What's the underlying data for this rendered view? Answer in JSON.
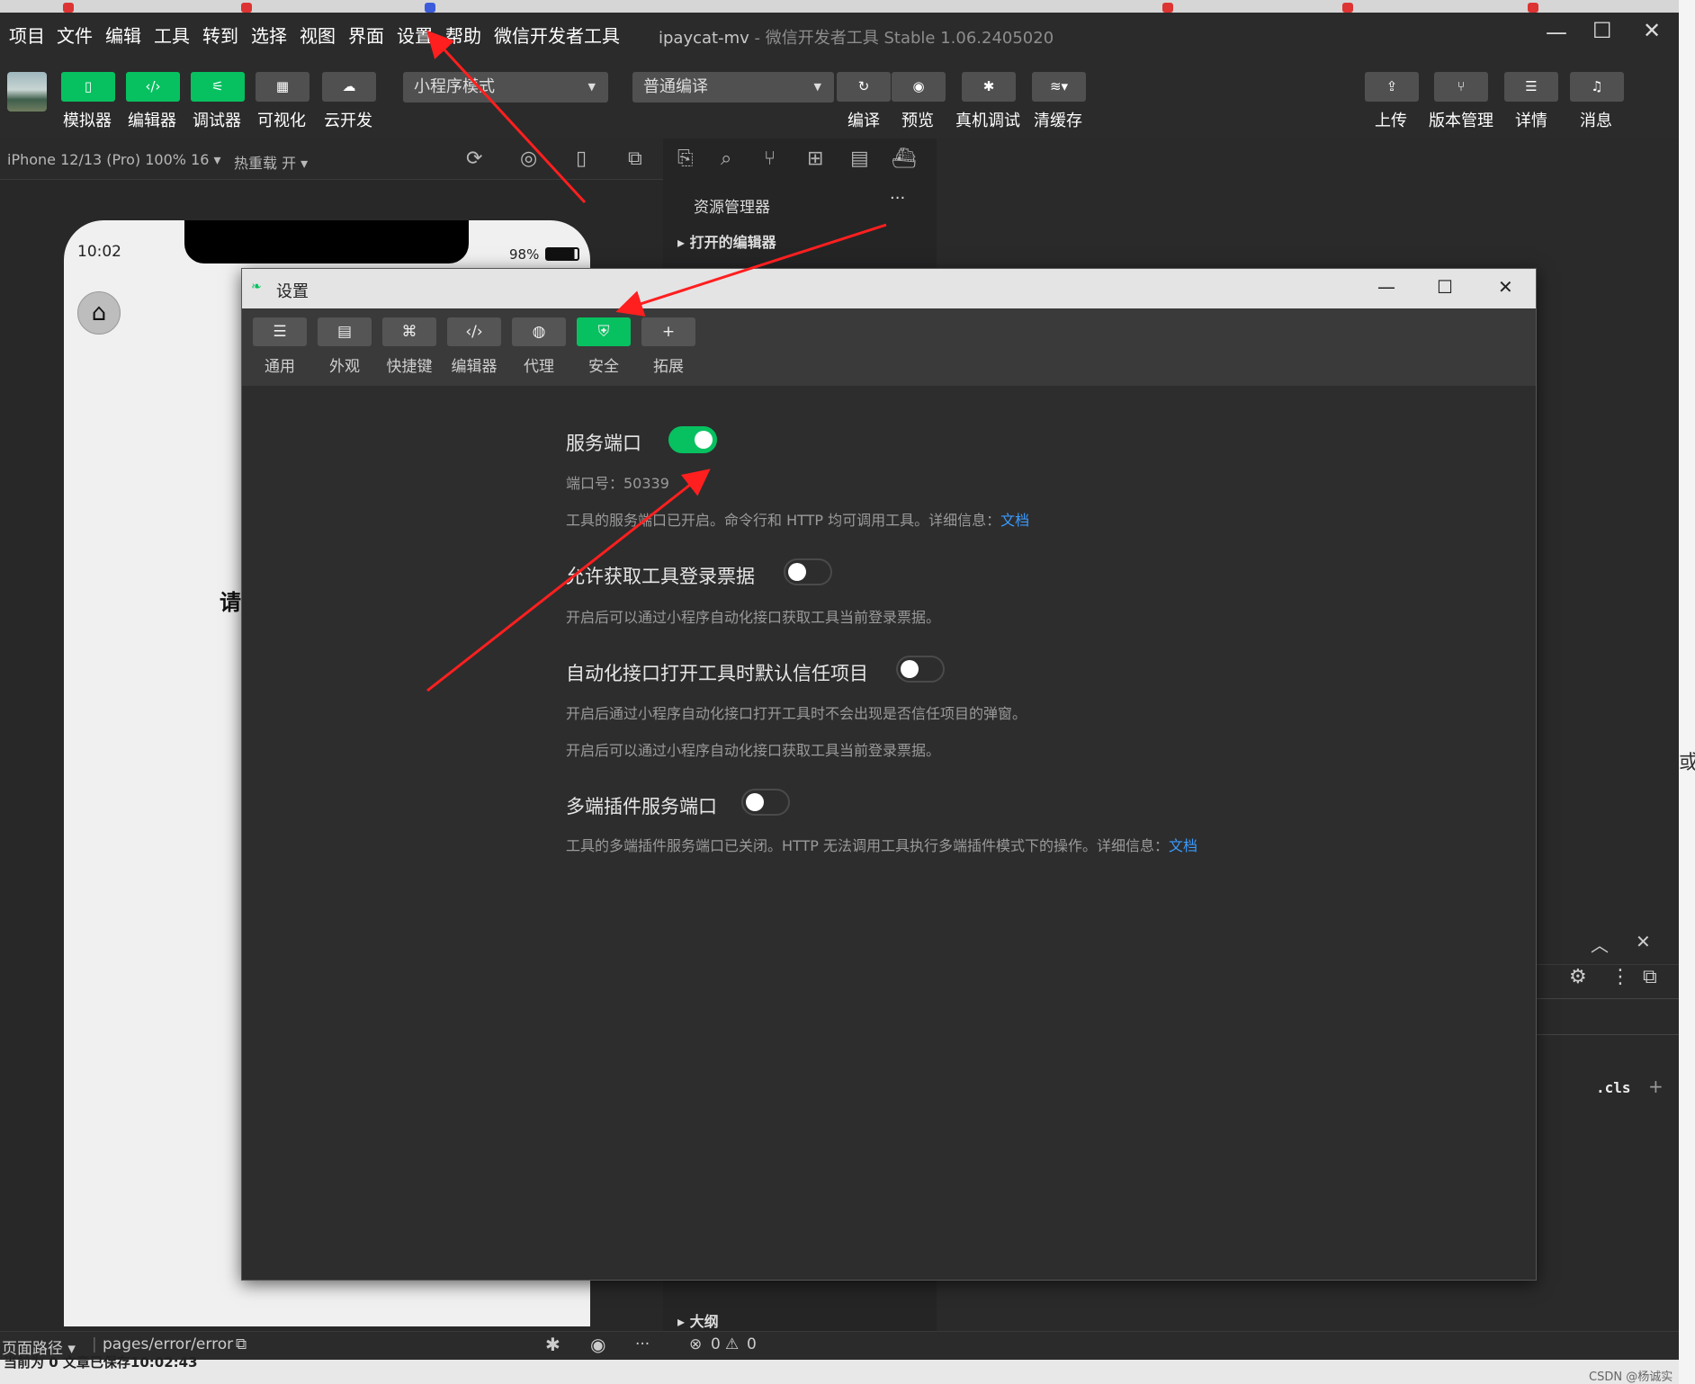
{
  "menu": [
    "项目",
    "文件",
    "编辑",
    "工具",
    "转到",
    "选择",
    "视图",
    "界面",
    "设置",
    "帮助",
    "微信开发者工具"
  ],
  "window": {
    "project": "ipaycat-mv",
    "product": "微信开发者工具 Stable 1.06.2405020"
  },
  "toolbar": {
    "left": [
      "模拟器",
      "编辑器",
      "调试器",
      "可视化",
      "云开发"
    ],
    "mode_select": "小程序模式",
    "compile_select": "普通编译",
    "actions": [
      "编译",
      "预览",
      "真机调试",
      "清缓存"
    ],
    "right": [
      "上传",
      "版本管理",
      "详情",
      "消息"
    ]
  },
  "simulator": {
    "device": "iPhone 12/13 (Pro) 100% 16",
    "hot_reload": "热重载 开",
    "time": "10:02",
    "battery": "98%",
    "page_char": "请"
  },
  "explorer": {
    "title": "资源管理器",
    "more": "···",
    "open_editors": "打开的编辑器",
    "outline": "大纲"
  },
  "debug_panel": {
    "cls": ".cls"
  },
  "dialog": {
    "title": "设置",
    "tabs": [
      "通用",
      "外观",
      "快捷键",
      "编辑器",
      "代理",
      "安全",
      "拓展"
    ],
    "active_tab": "安全",
    "settings": [
      {
        "label": "服务端口",
        "on": true,
        "lines": [
          "端口号：50339",
          "工具的服务端口已开启。命令行和 HTTP 均可调用工具。详细信息："
        ],
        "link": "文档"
      },
      {
        "label": "允许获取工具登录票据",
        "on": false,
        "lines": [
          "开启后可以通过小程序自动化接口获取工具当前登录票据。"
        ]
      },
      {
        "label": "自动化接口打开工具时默认信任项目",
        "on": false,
        "lines": [
          "开启后通过小程序自动化接口打开工具时不会出现是否信任项目的弹窗。",
          "开启后可以通过小程序自动化接口获取工具当前登录票据。"
        ]
      },
      {
        "label": "多端插件服务端口",
        "on": false,
        "lines": [
          "工具的多端插件服务端口已关闭。HTTP 无法调用工具执行多端插件模式下的操作。详细信息："
        ],
        "link": "文档"
      }
    ]
  },
  "statusbar": {
    "path_label": "页面路径",
    "path": "pages/error/error",
    "errors": "0",
    "warnings": "0"
  },
  "bottom": {
    "left": "当前为 0   文章已保存10:02:43",
    "watermark": "CSDN @杨诚实",
    "side_char": "或"
  },
  "colors": {
    "accent": "#07c160",
    "link": "#3b9bff",
    "annotation_arrow": "#ff1f1f"
  }
}
